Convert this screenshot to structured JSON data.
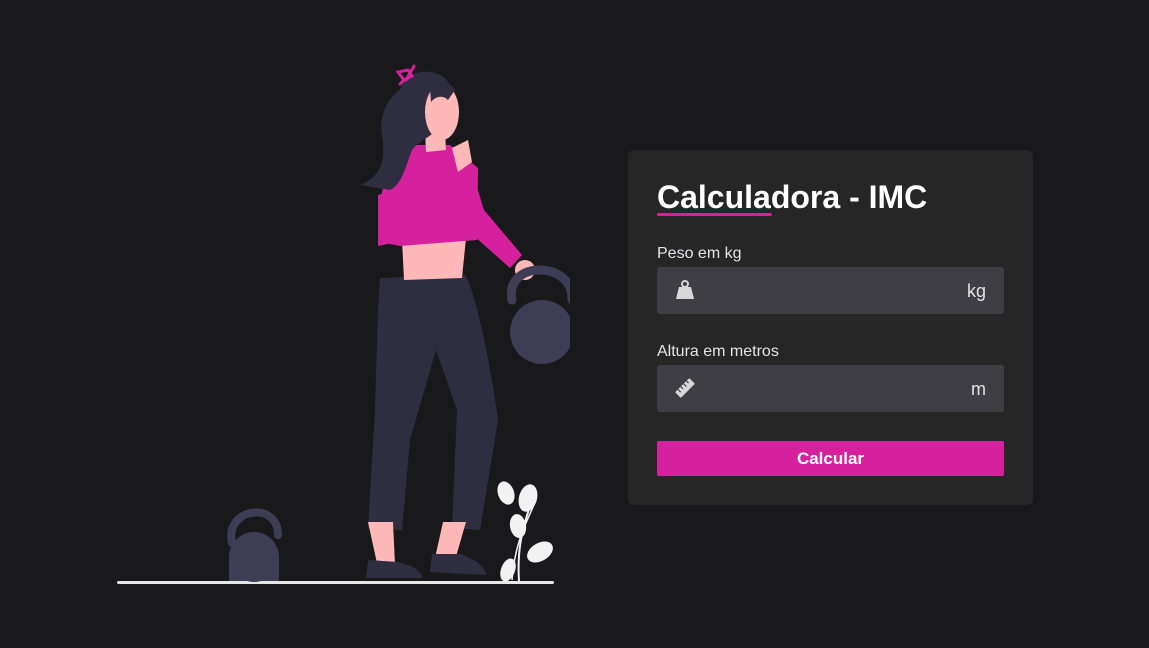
{
  "app": {
    "title": "Calculadora - IMC"
  },
  "form": {
    "weight": {
      "label": "Peso em kg",
      "value": "",
      "unit": "kg",
      "icon": "weight-icon"
    },
    "height": {
      "label": "Altura em metros",
      "value": "",
      "unit": "m",
      "icon": "ruler-icon"
    },
    "submit_label": "Calcular"
  },
  "colors": {
    "background": "#19181a",
    "card": "#262627",
    "input": "#3f3e44",
    "accent": "#d6219f",
    "figure_dark": "#2f2e41",
    "kettlebell": "#3f3d56",
    "skin": "#ffb8b8"
  }
}
